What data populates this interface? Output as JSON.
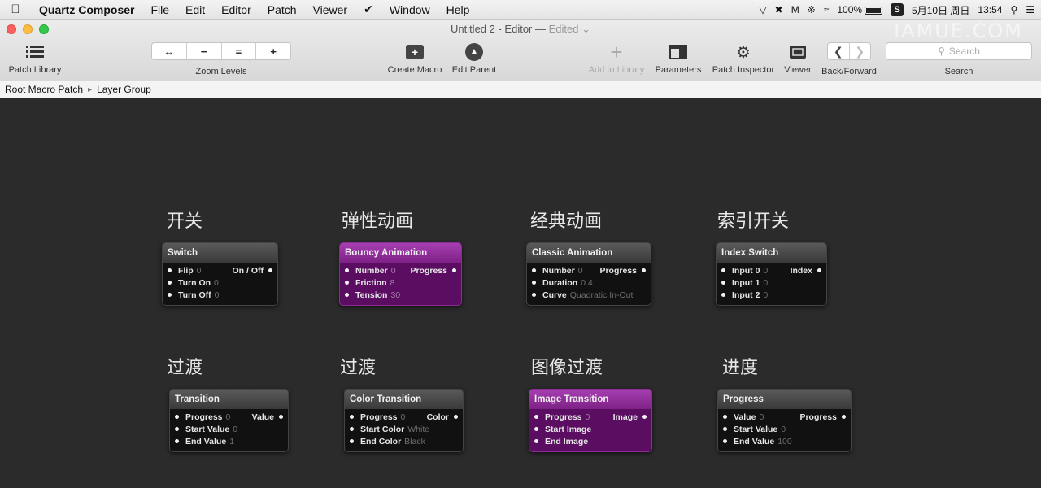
{
  "menubar": {
    "app_name": "Quartz Composer",
    "items": [
      "File",
      "Edit",
      "Editor",
      "Patch",
      "Viewer",
      "Window",
      "Help"
    ],
    "battery": "100%",
    "date": "5月10日 周日",
    "time": "13:54"
  },
  "window": {
    "title": "Untitled 2 - Editor",
    "edited": "Edited",
    "watermark": "IAMUE.COM"
  },
  "toolbar": {
    "patch_library": "Patch Library",
    "zoom_levels": "Zoom Levels",
    "zoom_buttons": [
      "↔",
      "−",
      "=",
      "+"
    ],
    "create_macro": "Create Macro",
    "edit_parent": "Edit Parent",
    "add_to_library": "Add to Library",
    "parameters": "Parameters",
    "patch_inspector": "Patch Inspector",
    "viewer": "Viewer",
    "back_forward": "Back/Forward",
    "search_label": "Search",
    "search_placeholder": "Search"
  },
  "breadcrumb": {
    "root": "Root Macro Patch",
    "current": "Layer Group"
  },
  "canvas": {
    "labels": {
      "switch": "开关",
      "bouncy": "弹性动画",
      "classic": "经典动画",
      "index_switch": "索引开关",
      "transition": "过渡",
      "color_transition": "过渡",
      "image_transition": "图像过渡",
      "progress": "进度"
    },
    "patches": {
      "switch": {
        "title": "Switch",
        "rows": [
          {
            "in": "Flip",
            "val": "0",
            "out": "On / Off"
          },
          {
            "in": "Turn On",
            "val": "0",
            "out": ""
          },
          {
            "in": "Turn Off",
            "val": "0",
            "out": ""
          }
        ]
      },
      "bouncy": {
        "title": "Bouncy Animation",
        "rows": [
          {
            "in": "Number",
            "val": "0",
            "out": "Progress"
          },
          {
            "in": "Friction",
            "val": "8",
            "out": ""
          },
          {
            "in": "Tension",
            "val": "30",
            "out": ""
          }
        ]
      },
      "classic": {
        "title": "Classic Animation",
        "rows": [
          {
            "in": "Number",
            "val": "0",
            "out": "Progress"
          },
          {
            "in": "Duration",
            "val": "0.4",
            "out": ""
          },
          {
            "in": "Curve",
            "val": "Quadratic In-Out",
            "out": ""
          }
        ]
      },
      "index_switch": {
        "title": "Index Switch",
        "rows": [
          {
            "in": "Input 0",
            "val": "0",
            "out": "Index"
          },
          {
            "in": "Input 1",
            "val": "0",
            "out": ""
          },
          {
            "in": "Input 2",
            "val": "0",
            "out": ""
          }
        ]
      },
      "transition": {
        "title": "Transition",
        "rows": [
          {
            "in": "Progress",
            "val": "0",
            "out": "Value"
          },
          {
            "in": "Start Value",
            "val": "0",
            "out": ""
          },
          {
            "in": "End Value",
            "val": "1",
            "out": ""
          }
        ]
      },
      "color_transition": {
        "title": "Color Transition",
        "rows": [
          {
            "in": "Progress",
            "val": "0",
            "out": "Color"
          },
          {
            "in": "Start Color",
            "val": "White",
            "out": ""
          },
          {
            "in": "End Color",
            "val": "Black",
            "out": ""
          }
        ]
      },
      "image_transition": {
        "title": "Image Transition",
        "rows": [
          {
            "in": "Progress",
            "val": "0",
            "out": "Image"
          },
          {
            "in": "Start Image",
            "val": "",
            "out": ""
          },
          {
            "in": "End Image",
            "val": "",
            "out": ""
          }
        ]
      },
      "progress": {
        "title": "Progress",
        "rows": [
          {
            "in": "Value",
            "val": "0",
            "out": "Progress"
          },
          {
            "in": "Start Value",
            "val": "0",
            "out": ""
          },
          {
            "in": "End Value",
            "val": "100",
            "out": ""
          }
        ]
      }
    }
  },
  "colors": {
    "canvas_bg": "#2b2b2b",
    "patch_gray_header": "#4a4a4a",
    "patch_purple_header": "#9a35a5",
    "patch_body": "#111111"
  }
}
